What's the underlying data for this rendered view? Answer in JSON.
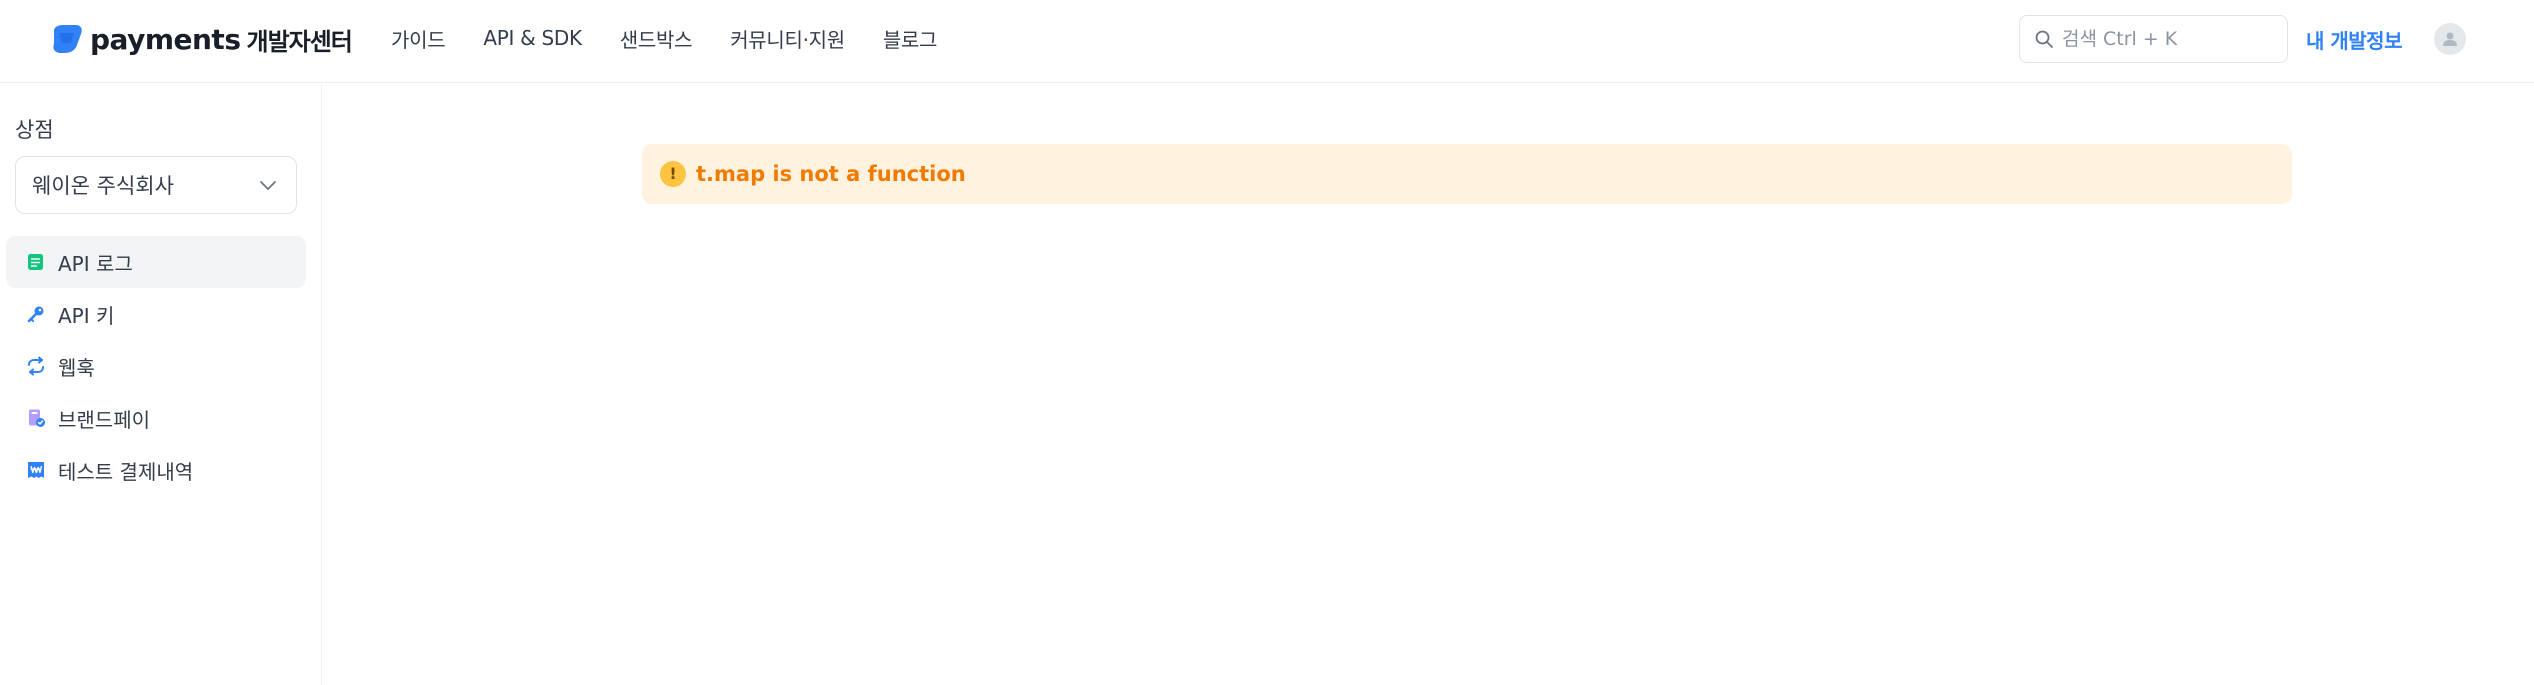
{
  "header": {
    "logo_text": "payments",
    "logo_sub": "개발자센터",
    "nav": [
      {
        "label": "가이드"
      },
      {
        "label": "API & SDK"
      },
      {
        "label": "샌드박스"
      },
      {
        "label": "커뮤니티·지원"
      },
      {
        "label": "블로그"
      }
    ],
    "search_placeholder": "검색 Ctrl + K",
    "my_dev_label": "내 개발정보"
  },
  "sidebar": {
    "store_label": "상점",
    "store_selected": "웨이온 주식회사",
    "items": [
      {
        "label": "API 로그",
        "icon": "document-list-icon",
        "active": true
      },
      {
        "label": "API 키",
        "icon": "key-icon",
        "active": false
      },
      {
        "label": "웹훅",
        "icon": "refresh-icon",
        "active": false
      },
      {
        "label": "브랜드페이",
        "icon": "brandpay-icon",
        "active": false
      },
      {
        "label": "테스트 결제내역",
        "icon": "won-receipt-icon",
        "active": false
      }
    ]
  },
  "main": {
    "alert_icon": "!",
    "alert_text": "t.map is not a function"
  },
  "colors": {
    "accent": "#3182f6",
    "alert_bg": "#fff2df",
    "alert_text": "#f07b00",
    "alert_icon": "#ffc342",
    "active_bg": "#f2f4f6"
  }
}
